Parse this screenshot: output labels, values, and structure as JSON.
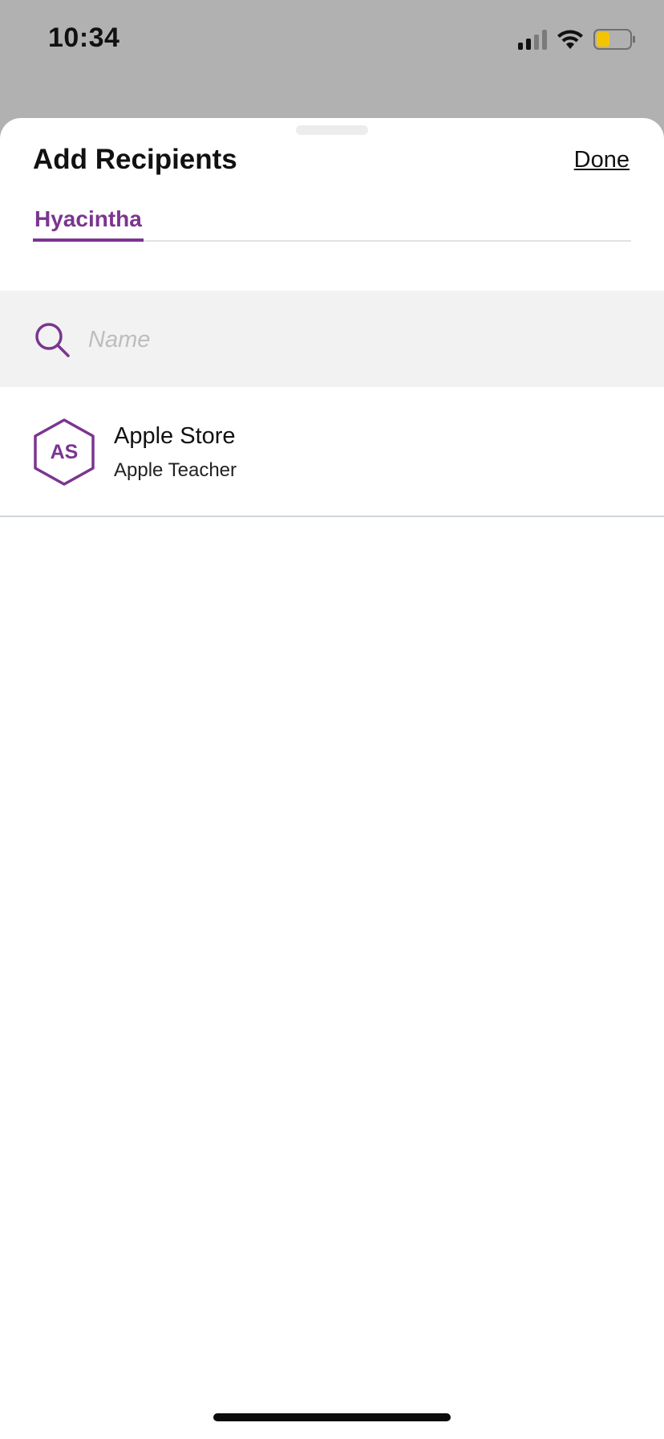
{
  "status_bar": {
    "time": "10:34",
    "icons": [
      "cellular-signal-icon",
      "wifi-icon",
      "battery-icon"
    ],
    "battery_level": 0.4,
    "battery_color": "#f5c400"
  },
  "sheet": {
    "title": "Add Recipients",
    "done_label": "Done"
  },
  "tabs": [
    {
      "label": "Hyacintha",
      "active": true
    }
  ],
  "search": {
    "placeholder": "Name",
    "value": "",
    "icon": "search-icon"
  },
  "recipients": [
    {
      "initials": "AS",
      "name": "Apple Store",
      "subtitle": "Apple Teacher"
    }
  ],
  "colors": {
    "accent": "#7b3590",
    "overlay": "#b1b1b1",
    "search_bg": "#f2f2f2"
  }
}
